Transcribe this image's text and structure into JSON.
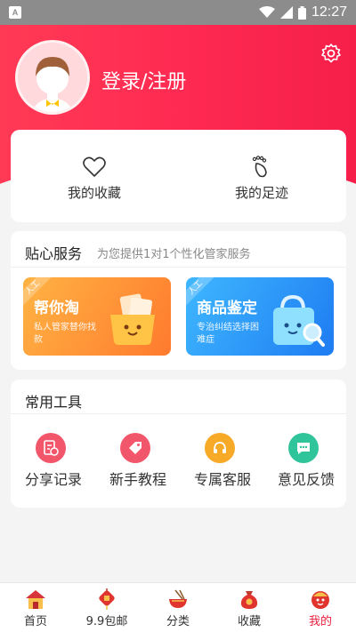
{
  "status_bar": {
    "time": "12:27",
    "app_icon_letter": "A"
  },
  "header": {
    "login_text": "登录/注册"
  },
  "favorites": {
    "items": [
      {
        "label": "我的收藏",
        "icon": "heart-icon"
      },
      {
        "label": "我的足迹",
        "icon": "footprint-icon"
      }
    ]
  },
  "service": {
    "title": "贴心服务",
    "subtitle": "为您提供1对1个性化管家服务",
    "cards": [
      {
        "tag": "人工",
        "title": "帮你淘",
        "desc": "私人管家替你找款",
        "accent": "#ff8a30"
      },
      {
        "tag": "人工",
        "title": "商品鉴定",
        "desc": "专治纠结选择困难症",
        "accent": "#2a8df5"
      }
    ]
  },
  "tools": {
    "title": "常用工具",
    "items": [
      {
        "label": "分享记录",
        "icon": "share-record-icon",
        "color": "#f2566b"
      },
      {
        "label": "新手教程",
        "icon": "tag-icon",
        "color": "#f2566b"
      },
      {
        "label": "专属客服",
        "icon": "headset-icon",
        "color": "#f7a928"
      },
      {
        "label": "意见反馈",
        "icon": "chat-icon",
        "color": "#2fc49a"
      }
    ]
  },
  "bottom_nav": {
    "items": [
      {
        "label": "首页",
        "icon": "home-icon"
      },
      {
        "label": "9.9包邮",
        "icon": "lantern-icon"
      },
      {
        "label": "分类",
        "icon": "bowl-icon"
      },
      {
        "label": "收藏",
        "icon": "bag-icon"
      },
      {
        "label": "我的",
        "icon": "profile-icon"
      }
    ],
    "active_index": 4,
    "active_color": "#e8213f"
  }
}
